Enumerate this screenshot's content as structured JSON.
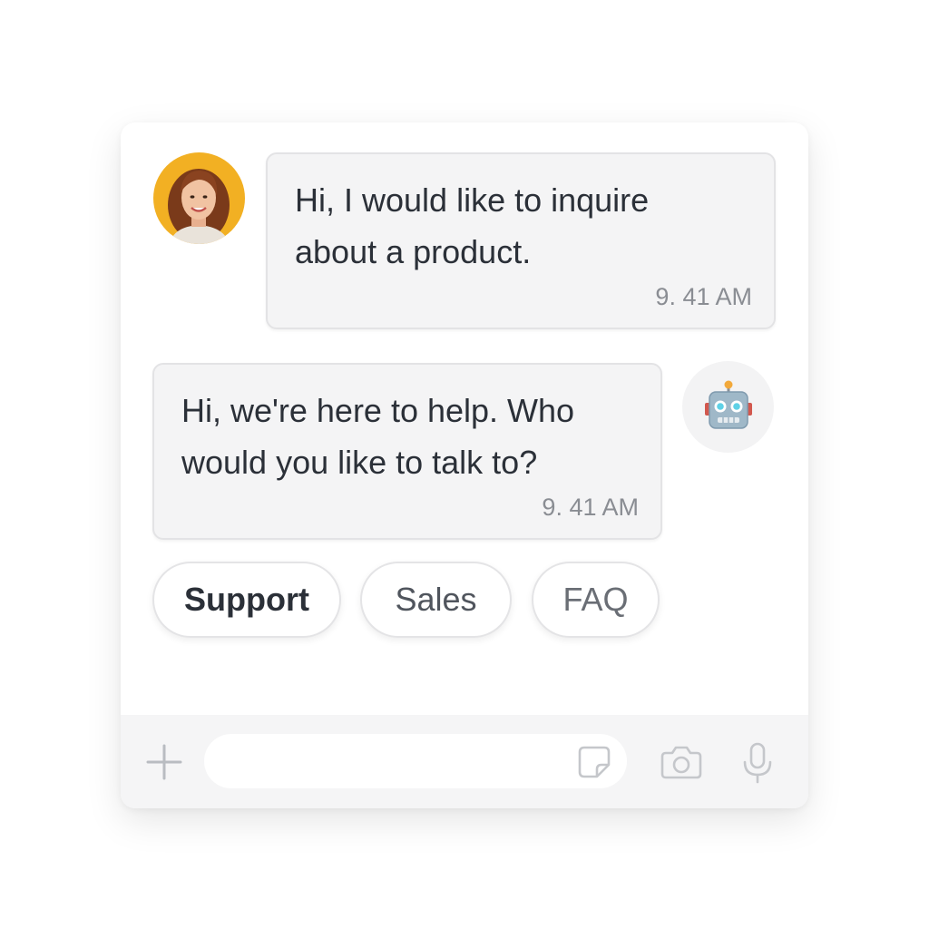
{
  "messages": [
    {
      "sender": "user",
      "avatar": "user-photo-avatar",
      "line1": "Hi, I would like to inquire",
      "line2": "about a product.",
      "time": "9. 41 AM"
    },
    {
      "sender": "bot",
      "avatar": "robot-icon",
      "line1": "Hi, we're here to help. Who",
      "line2": "would you like to talk to?",
      "time": "9. 41 AM"
    }
  ],
  "quick_replies": [
    "Support",
    "Sales",
    "FAQ"
  ],
  "composer": {
    "placeholder": "",
    "icons": [
      "plus-icon",
      "sticker-icon",
      "camera-icon",
      "microphone-icon"
    ]
  },
  "colors": {
    "user_avatar_bg": "#f2b023",
    "bubble_bg": "#f4f4f5",
    "text": "#2b3038",
    "timestamp": "#8a8d93"
  }
}
